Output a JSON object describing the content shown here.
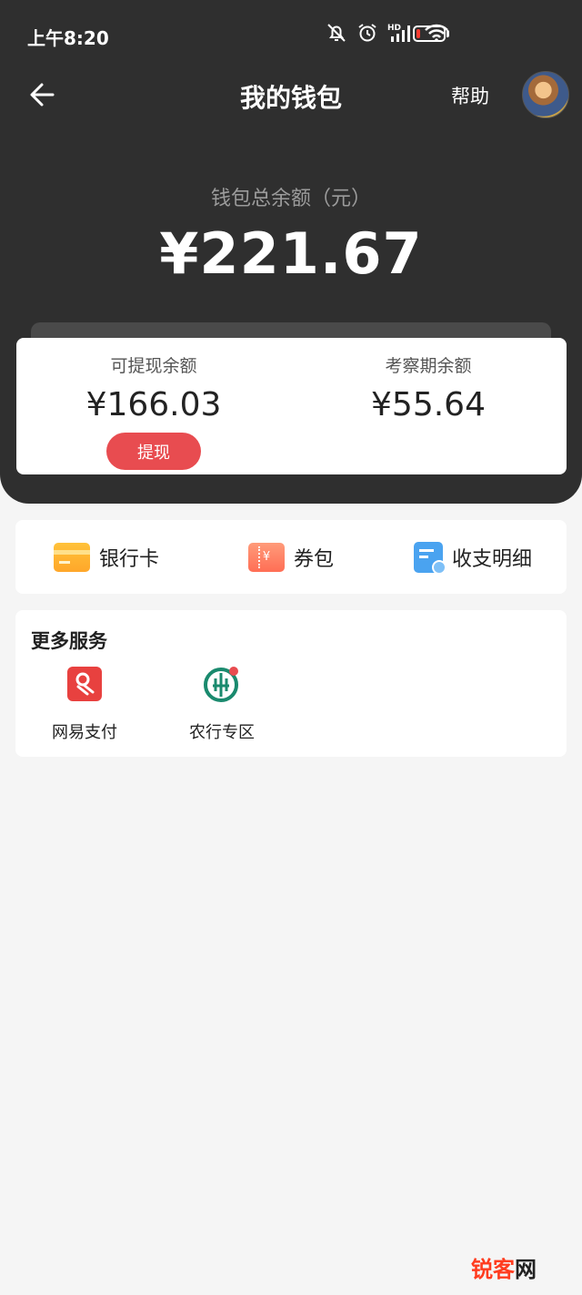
{
  "status_bar": {
    "time": "上午8:20",
    "icons": [
      "bell-muted-icon",
      "alarm-icon",
      "signal-hd-icon",
      "wifi-icon",
      "battery-low-icon"
    ],
    "battery_level": 0.15,
    "battery_color": "#ff3b30"
  },
  "nav": {
    "title": "我的钱包",
    "help_label": "帮助"
  },
  "wallet": {
    "total_label": "钱包总余额（元）",
    "total_amount": "¥221.67"
  },
  "balances": {
    "withdrawable_label": "可提现余额",
    "withdrawable_amount": "¥166.03",
    "withdraw_button": "提现",
    "review_label": "考察期余额",
    "review_amount": "¥55.64"
  },
  "quick_links": [
    {
      "label": "银行卡",
      "icon": "bank-card-icon"
    },
    {
      "label": "券包",
      "icon": "coupon-icon"
    },
    {
      "label": "收支明细",
      "icon": "transaction-details-icon"
    }
  ],
  "services": {
    "title": "更多服务",
    "items": [
      {
        "label": "网易支付",
        "icon": "netease-pay-icon"
      },
      {
        "label": "农行专区",
        "icon": "abc-bank-icon"
      }
    ]
  },
  "watermark": {
    "part1": "锐客",
    "part2": "网"
  },
  "colors": {
    "header_bg": "#2f2f2f",
    "accent_red": "#e84c50",
    "page_bg": "#f5f5f5"
  }
}
